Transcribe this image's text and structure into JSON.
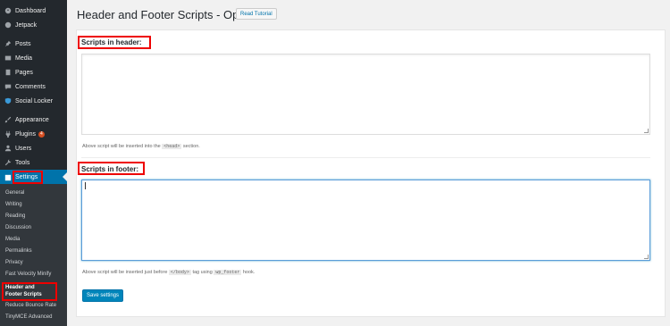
{
  "sidebar": {
    "items": [
      {
        "label": "Dashboard",
        "icon": "dashboard-icon"
      },
      {
        "label": "Jetpack",
        "icon": "jetpack-icon"
      },
      {
        "label": "Posts",
        "icon": "pin-icon"
      },
      {
        "label": "Media",
        "icon": "media-icon"
      },
      {
        "label": "Pages",
        "icon": "pages-icon"
      },
      {
        "label": "Comments",
        "icon": "comment-icon"
      },
      {
        "label": "Social Locker",
        "icon": "shield-icon"
      },
      {
        "label": "Appearance",
        "icon": "paintbrush-icon"
      },
      {
        "label": "Plugins",
        "icon": "plug-icon",
        "badge": "4"
      },
      {
        "label": "Users",
        "icon": "user-icon"
      },
      {
        "label": "Tools",
        "icon": "wrench-icon"
      },
      {
        "label": "Settings",
        "icon": "settings-icon"
      }
    ],
    "submenu": [
      "General",
      "Writing",
      "Reading",
      "Discussion",
      "Media",
      "Permalinks",
      "Privacy",
      "Fast Velocity Minify",
      "Header and Footer Scripts",
      "Reduce Bounce Rate",
      "TinyMCE Advanced"
    ]
  },
  "main": {
    "title": "Header and Footer Scripts - Options",
    "title_button": "Read Tutorial",
    "header_section": {
      "label": "Scripts in header:",
      "value": "",
      "desc_before": "Above script will be inserted into the",
      "desc_code": "<head>",
      "desc_after": "section."
    },
    "footer_section": {
      "label": "Scripts in footer:",
      "value": "",
      "desc_before": "Above script will be inserted just before",
      "desc_code": "</body>",
      "desc_mid": "tag using",
      "desc_code2": "wp_footer",
      "desc_after": "hook."
    },
    "save_button": "Save settings"
  },
  "colors": {
    "sidebar_bg": "#23282d",
    "active": "#0073aa",
    "highlight": "#e00000"
  }
}
